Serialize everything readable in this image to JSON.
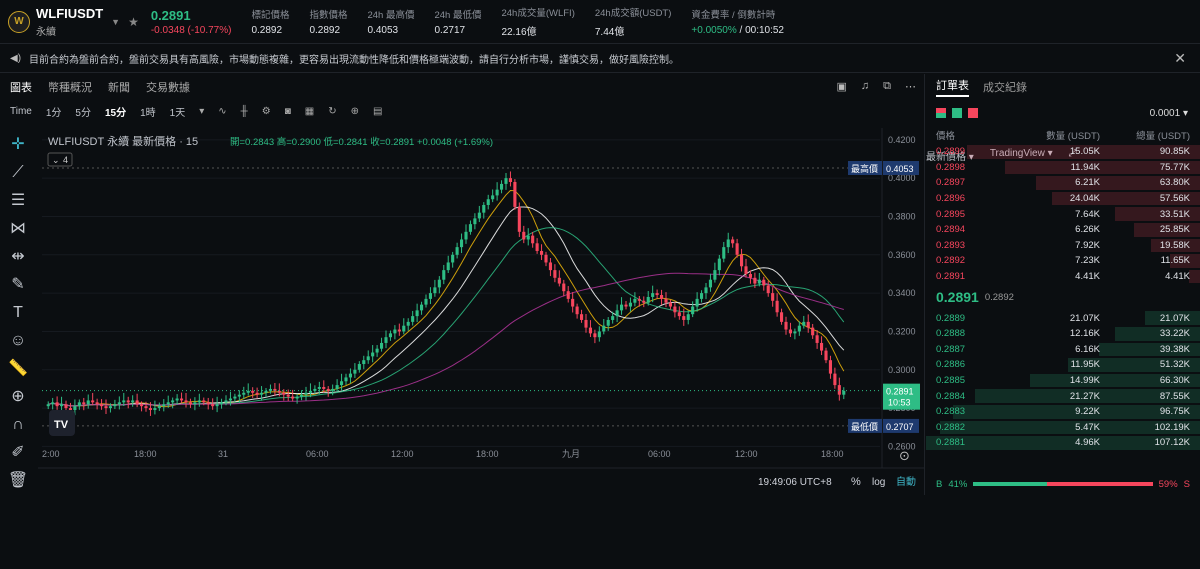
{
  "header": {
    "symbol": "WLFIUSDT",
    "contract_type": "永續",
    "last_price": "0.2891",
    "change": "-0.0348 (-10.77%)",
    "stats": [
      {
        "label": "標記價格",
        "value": "0.2892"
      },
      {
        "label": "指數價格",
        "value": "0.2892"
      },
      {
        "label": "24h 最高價",
        "value": "0.4053"
      },
      {
        "label": "24h 最低價",
        "value": "0.2717"
      },
      {
        "label": "24h成交量(WLFI)",
        "value": "22.16億"
      },
      {
        "label": "24h成交額(USDT)",
        "value": "7.44億"
      }
    ],
    "funding_label": "資金費率 / 倒數計時",
    "funding_rate": "+0.0050%",
    "funding_countdown": " / 00:10:52"
  },
  "notice": "目前合約為盤前合約，盤前交易具有高風險，市場動態複雜，更容易出現流動性降低和價格極端波動，請自行分析市場，謹慎交易，做好風險控制。",
  "tabs": [
    "圖表",
    "幣種概況",
    "新聞",
    "交易數據"
  ],
  "toolbar": {
    "intervals": [
      "Time",
      "1分",
      "5分",
      "15分",
      "1時",
      "1天"
    ],
    "active_interval": "15分",
    "price_type": "最新價格",
    "view": "TradingView"
  },
  "chart_data": {
    "type": "candlestick",
    "legend_title": "WLFIUSDT 永續 最新價格 · 15",
    "ohlc_text": "開=0.2843 高=0.2900 低=0.2841 收=0.2891 +0.0048 (+1.69%)",
    "indicators_count": "4",
    "y_ticks": [
      "0.4200",
      "0.4000",
      "0.3800",
      "0.3600",
      "0.3400",
      "0.3200",
      "0.3000",
      "0.2800",
      "0.2600"
    ],
    "ylim": [
      0.255,
      0.422
    ],
    "x_ticks": [
      "2:00",
      "18:00",
      "31",
      "06:00",
      "12:00",
      "18:00",
      "九月",
      "06:00",
      "12:00",
      "18:00"
    ],
    "high_label": "最高價",
    "high_value": "0.4053",
    "low_label": "最低價",
    "low_value": "0.2707",
    "current_price": "0.2891",
    "current_countdown": "10:53",
    "closes": [
      0.282,
      0.283,
      0.281,
      0.282,
      0.28,
      0.279,
      0.281,
      0.283,
      0.282,
      0.284,
      0.283,
      0.282,
      0.281,
      0.28,
      0.281,
      0.282,
      0.283,
      0.284,
      0.283,
      0.284,
      0.282,
      0.281,
      0.28,
      0.279,
      0.28,
      0.281,
      0.282,
      0.283,
      0.284,
      0.285,
      0.284,
      0.283,
      0.282,
      0.283,
      0.284,
      0.283,
      0.282,
      0.281,
      0.282,
      0.283,
      0.284,
      0.285,
      0.286,
      0.287,
      0.288,
      0.289,
      0.288,
      0.287,
      0.288,
      0.289,
      0.29,
      0.289,
      0.288,
      0.287,
      0.286,
      0.285,
      0.286,
      0.287,
      0.288,
      0.289,
      0.29,
      0.291,
      0.29,
      0.289,
      0.29,
      0.292,
      0.294,
      0.296,
      0.298,
      0.3,
      0.303,
      0.305,
      0.307,
      0.309,
      0.311,
      0.314,
      0.317,
      0.319,
      0.321,
      0.32,
      0.323,
      0.325,
      0.328,
      0.331,
      0.334,
      0.337,
      0.34,
      0.343,
      0.347,
      0.352,
      0.356,
      0.36,
      0.364,
      0.368,
      0.372,
      0.376,
      0.379,
      0.382,
      0.386,
      0.389,
      0.391,
      0.394,
      0.397,
      0.4,
      0.398,
      0.385,
      0.372,
      0.368,
      0.37,
      0.366,
      0.362,
      0.36,
      0.356,
      0.352,
      0.348,
      0.345,
      0.341,
      0.337,
      0.333,
      0.329,
      0.326,
      0.322,
      0.319,
      0.317,
      0.32,
      0.323,
      0.326,
      0.328,
      0.331,
      0.334,
      0.333,
      0.335,
      0.337,
      0.336,
      0.335,
      0.338,
      0.34,
      0.339,
      0.337,
      0.335,
      0.333,
      0.33,
      0.328,
      0.326,
      0.329,
      0.333,
      0.337,
      0.34,
      0.343,
      0.347,
      0.352,
      0.358,
      0.364,
      0.368,
      0.366,
      0.36,
      0.354,
      0.35,
      0.348,
      0.345,
      0.347,
      0.344,
      0.34,
      0.336,
      0.33,
      0.325,
      0.321,
      0.319,
      0.32,
      0.323,
      0.325,
      0.322,
      0.318,
      0.314,
      0.31,
      0.305,
      0.298,
      0.292,
      0.287,
      0.289
    ],
    "ma_series": [
      {
        "color": "#f0b90b"
      },
      {
        "color": "#ffffff"
      },
      {
        "color": "#2ebd85"
      },
      {
        "color": "#b4359c"
      }
    ]
  },
  "drawing_tools": [
    "crosshair-icon",
    "trendline-icon",
    "fib-icon",
    "pattern-icon",
    "measure-icon",
    "brush-icon",
    "text-icon",
    "emoji-icon",
    "ruler-icon",
    "zoom-icon",
    "magnet-icon",
    "lock-icon",
    "trash-icon"
  ],
  "footer": {
    "time": "19:49:06 UTC+8",
    "percent": "%",
    "log": "log",
    "auto": "自動"
  },
  "orderbook": {
    "tabs": [
      "訂單表",
      "成交紀錄"
    ],
    "tick_size": "0.0001",
    "headers": [
      "價格",
      "數量 (USDT)",
      "總量 (USDT)"
    ],
    "asks": [
      {
        "price": "0.2899",
        "qty": "15.05K",
        "total": "90.85K",
        "depth": 0.85
      },
      {
        "price": "0.2898",
        "qty": "11.94K",
        "total": "75.77K",
        "depth": 0.71
      },
      {
        "price": "0.2897",
        "qty": "6.21K",
        "total": "63.80K",
        "depth": 0.6
      },
      {
        "price": "0.2896",
        "qty": "24.04K",
        "total": "57.56K",
        "depth": 0.54
      },
      {
        "price": "0.2895",
        "qty": "7.64K",
        "total": "33.51K",
        "depth": 0.31
      },
      {
        "price": "0.2894",
        "qty": "6.26K",
        "total": "25.85K",
        "depth": 0.24
      },
      {
        "price": "0.2893",
        "qty": "7.92K",
        "total": "19.58K",
        "depth": 0.18
      },
      {
        "price": "0.2892",
        "qty": "7.23K",
        "total": "11.65K",
        "depth": 0.11
      },
      {
        "price": "0.2891",
        "qty": "4.41K",
        "total": "4.41K",
        "depth": 0.04
      }
    ],
    "mid_price": "0.2891",
    "mark_price": "0.2892",
    "bids": [
      {
        "price": "0.2889",
        "qty": "21.07K",
        "total": "21.07K",
        "depth": 0.2
      },
      {
        "price": "0.2888",
        "qty": "12.16K",
        "total": "33.22K",
        "depth": 0.31
      },
      {
        "price": "0.2887",
        "qty": "6.16K",
        "total": "39.38K",
        "depth": 0.37
      },
      {
        "price": "0.2886",
        "qty": "11.95K",
        "total": "51.32K",
        "depth": 0.48
      },
      {
        "price": "0.2885",
        "qty": "14.99K",
        "total": "66.30K",
        "depth": 0.62
      },
      {
        "price": "0.2884",
        "qty": "21.27K",
        "total": "87.55K",
        "depth": 0.82
      },
      {
        "price": "0.2883",
        "qty": "9.22K",
        "total": "96.75K",
        "depth": 0.9
      },
      {
        "price": "0.2882",
        "qty": "5.47K",
        "total": "102.19K",
        "depth": 0.95
      },
      {
        "price": "0.2881",
        "qty": "4.96K",
        "total": "107.12K",
        "depth": 1.0
      }
    ],
    "buy_ratio_label": "B",
    "buy_ratio": "41%",
    "sell_ratio": "59%",
    "sell_ratio_label": "S",
    "buy_fraction": 0.41
  }
}
